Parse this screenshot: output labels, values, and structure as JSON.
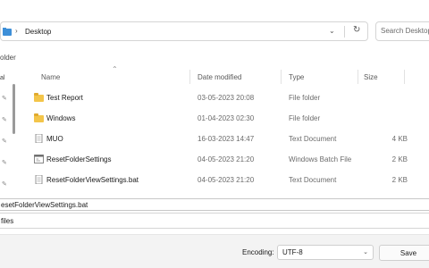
{
  "address_bar": {
    "path": "Desktop",
    "separator": "›",
    "dropdown_glyph": "⌄",
    "refresh_glyph": "↻"
  },
  "search": {
    "placeholder": "Search Desktop"
  },
  "toolbar": {
    "new_folder_label": "older"
  },
  "nav_pane": {
    "quick_access_label": "al"
  },
  "columns": {
    "name": "Name",
    "date": "Date modified",
    "type": "Type",
    "size": "Size"
  },
  "files": [
    {
      "name": "Test Report",
      "date": "03-05-2023 20:08",
      "type": "File folder",
      "size": "",
      "icon": "folder-icon"
    },
    {
      "name": "Windows",
      "date": "01-04-2023 02:30",
      "type": "File folder",
      "size": "",
      "icon": "folder-icon"
    },
    {
      "name": "MUO",
      "date": "16-03-2023 14:47",
      "type": "Text Document",
      "size": "4 KB",
      "icon": "text-document-icon"
    },
    {
      "name": "ResetFolderSettings",
      "date": "04-05-2023 21:20",
      "type": "Windows Batch File",
      "size": "2 KB",
      "icon": "batch-file-icon"
    },
    {
      "name": "ResetFolderViewSettings.bat",
      "date": "04-05-2023 21:20",
      "type": "Text Document",
      "size": "2 KB",
      "icon": "text-document-icon"
    }
  ],
  "file_name": {
    "value": "esetFolderViewSettings.bat"
  },
  "save_as_type": {
    "value": "files"
  },
  "encoding": {
    "label": "Encoding:",
    "value": "UTF-8",
    "options": [
      "UTF-8"
    ]
  },
  "buttons": {
    "save_label": "Save"
  },
  "colors": {
    "folder": "#f3c54a",
    "accent": "#0078d4",
    "bottom_bar": "#f3f3f3"
  }
}
